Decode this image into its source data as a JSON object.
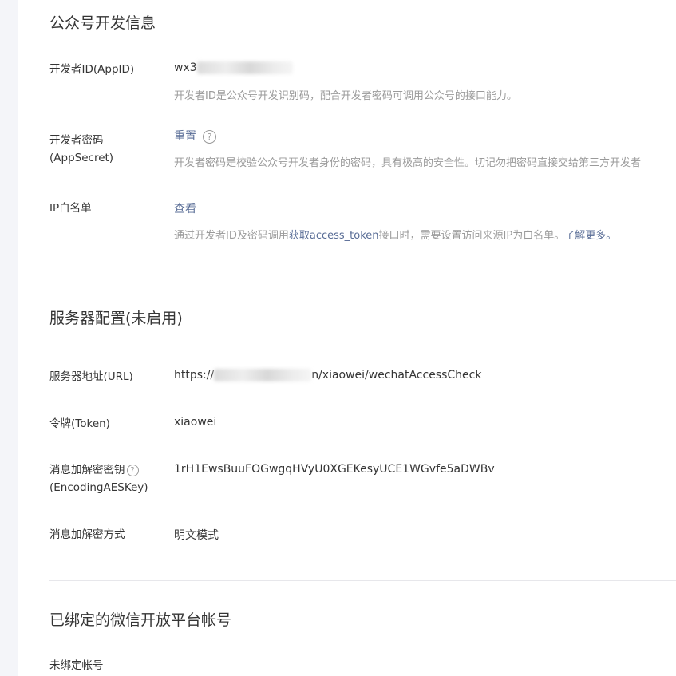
{
  "sections": {
    "dev_info": {
      "title": "公众号开发信息",
      "appid": {
        "label": "开发者ID(AppID)",
        "value_prefix": "wx3",
        "desc": "开发者ID是公众号开发识别码，配合开发者密码可调用公众号的接口能力。"
      },
      "appsecret": {
        "label_line1": "开发者密码",
        "label_line2": "(AppSecret)",
        "action": "重置",
        "help_icon": "question-circle",
        "desc": "开发者密码是校验公众号开发者身份的密码，具有极高的安全性。切记勿把密码直接交给第三方开发者"
      },
      "ip_whitelist": {
        "label": "IP白名单",
        "action": "查看",
        "desc_before": "通过开发者ID及密码调用",
        "desc_link": "获取access_token",
        "desc_after": "接口时，需要设置访问来源IP为白名单。",
        "learn_more": "了解更多"
      }
    },
    "server_config": {
      "title": "服务器配置(未启用)",
      "url": {
        "label": "服务器地址(URL)",
        "value_prefix": "https://",
        "value_suffix": "n/xiaowei/wechatAccessCheck"
      },
      "token": {
        "label": "令牌(Token)",
        "value": "xiaowei"
      },
      "aeskey": {
        "label_line1": "消息加解密密钥",
        "label_line2": "(EncodingAESKey)",
        "help_icon": "question-circle",
        "value": "1rH1EwsBuuFOGwgqHVyU0XGEKesyUCE1WGvfe5aDWBv"
      },
      "encrypt_mode": {
        "label": "消息加解密方式",
        "value": "明文模式"
      }
    },
    "open_platform": {
      "title": "已绑定的微信开放平台帐号",
      "status_label": "未绑定帐号"
    }
  },
  "colors": {
    "text": "#353535",
    "muted": "#9a9a9a",
    "link": "#576b95",
    "divider": "#e7e7eb",
    "side_strip": "#f4f5f9"
  }
}
